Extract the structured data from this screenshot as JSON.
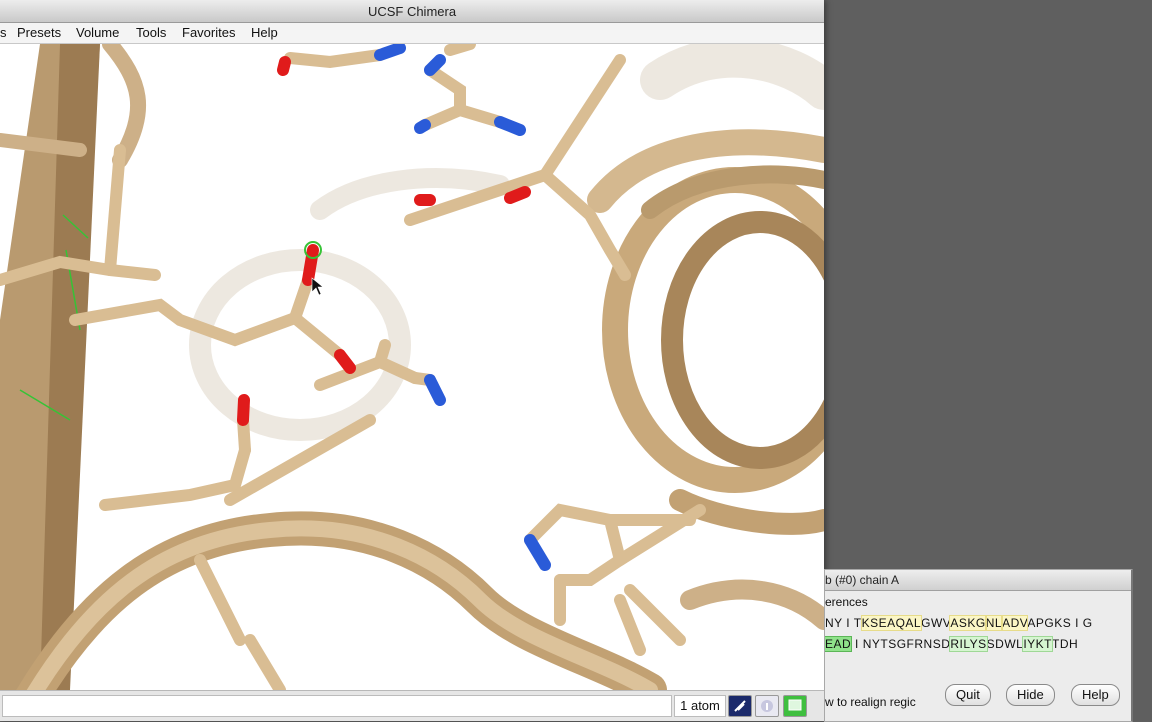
{
  "window": {
    "title": "UCSF Chimera"
  },
  "menu": {
    "items": [
      "s",
      "Presets",
      "Volume",
      "Tools",
      "Favorites",
      "Help"
    ]
  },
  "statusbar": {
    "atom_count": "1 atom"
  },
  "sequence_window": {
    "title": "b (#0) chain A",
    "section_label": "erences",
    "seq1": {
      "a": "NY I T",
      "b": "KSEAQAL",
      "c": "GWV",
      "d": "ASKG",
      "e": "NL",
      "f": "ADV",
      "g": "APGKS I G"
    },
    "seq2": {
      "a": "EAD",
      "b": " I NYTSGFRNSD",
      "c": "RILYS",
      "d": "SDWL",
      "e": "IYKT",
      "f": "TDH"
    },
    "help_text": "w to realign regic",
    "buttons": {
      "quit": "Quit",
      "hide": "Hide",
      "help": "Help"
    }
  },
  "colors": {
    "carbon": "#d6b98c",
    "oxygen": "#e01b1b",
    "nitrogen": "#2a5bd8",
    "selection": "#36c336"
  }
}
